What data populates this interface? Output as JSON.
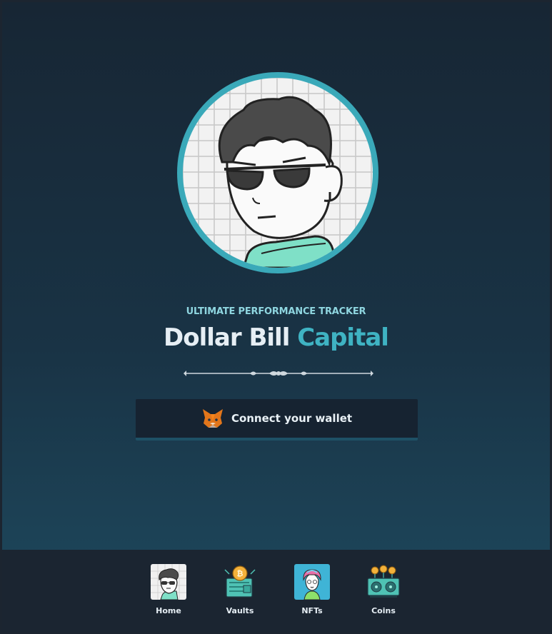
{
  "hero": {
    "kicker": "ULTIMATE PERFORMANCE TRACKER",
    "title_part1": "Dollar Bill",
    "title_part2": "Capital"
  },
  "connect": {
    "label": "Connect your wallet",
    "icon": "metamask-fox-icon"
  },
  "nav": {
    "items": [
      {
        "label": "Home",
        "icon": "avatar-home-icon"
      },
      {
        "label": "Vaults",
        "icon": "bitcoin-vault-icon"
      },
      {
        "label": "NFTs",
        "icon": "nft-character-icon"
      },
      {
        "label": "Coins",
        "icon": "coin-mining-rig-icon"
      }
    ]
  },
  "colors": {
    "accent": "#3fb3c3",
    "kicker": "#8fd6e0",
    "nav_background": "#1b2531",
    "button_background": "#162331"
  }
}
